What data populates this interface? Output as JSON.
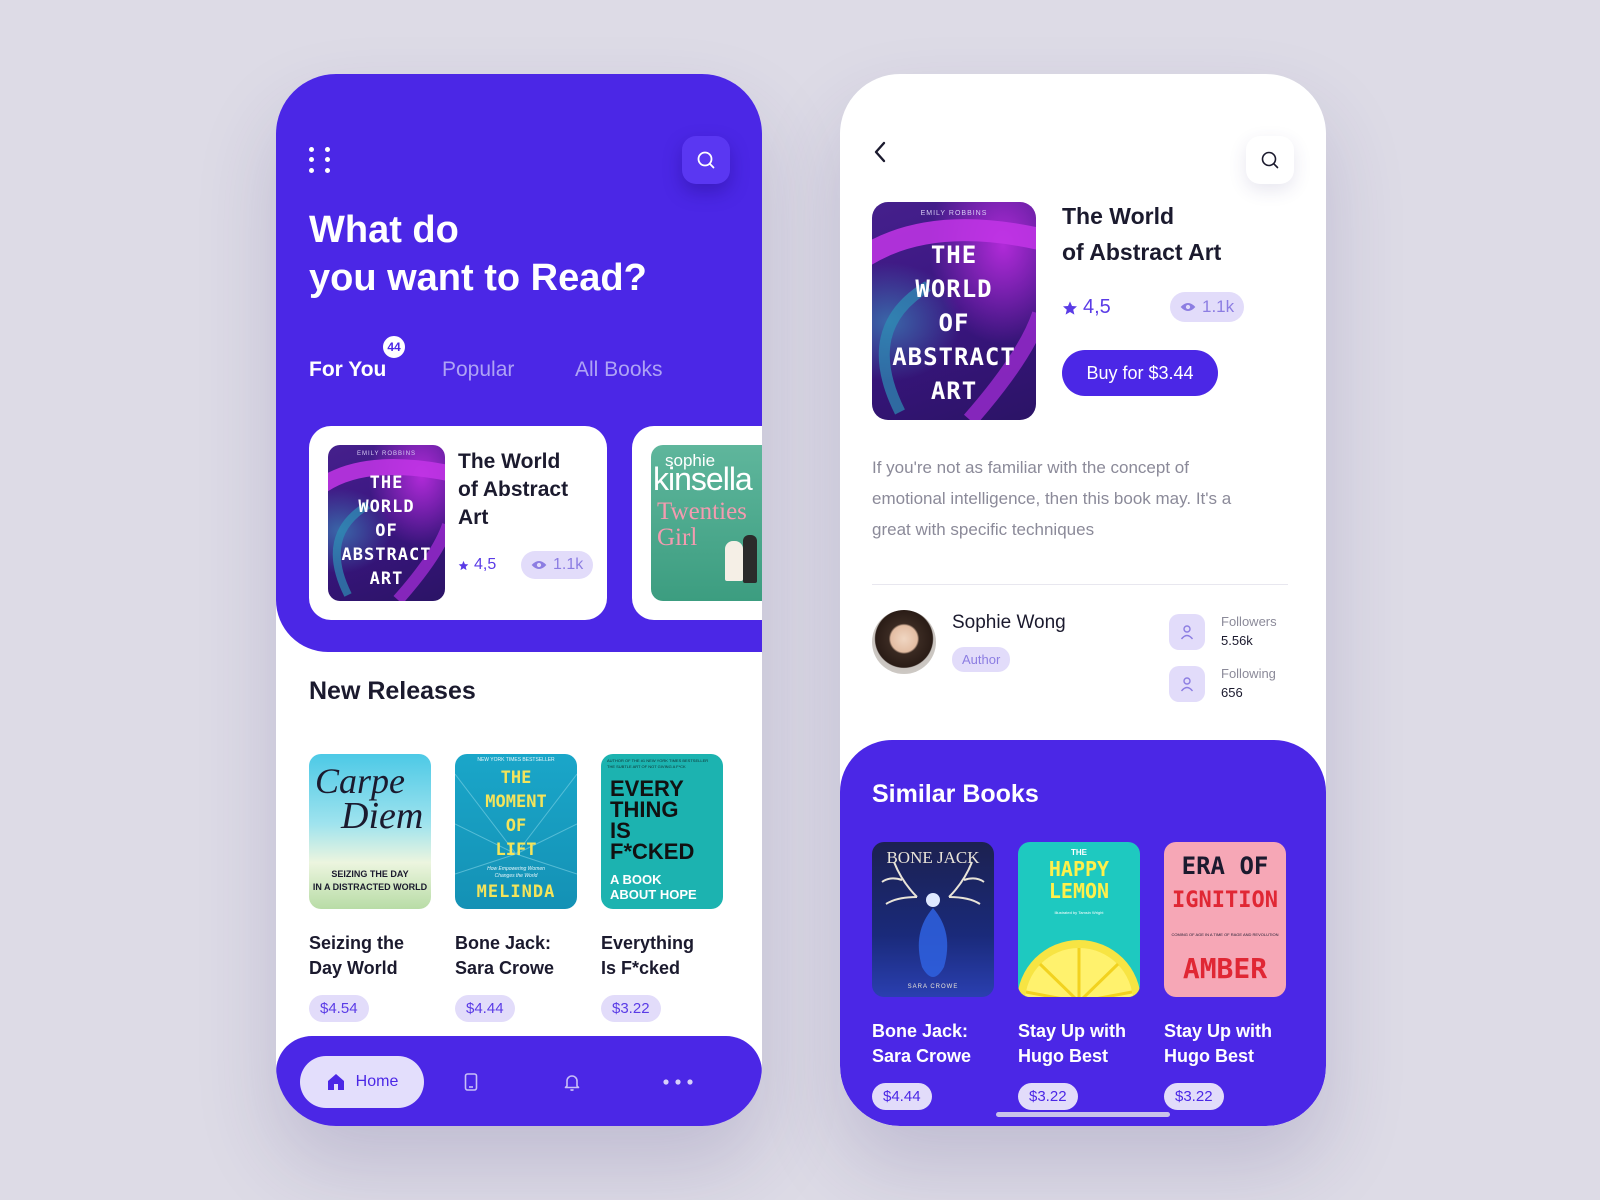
{
  "colors": {
    "background": "#dddbe6",
    "primary": "#4b27e6",
    "pill_bg": "#e2dcfa",
    "text_dark": "#1b1a2e",
    "text_muted": "#8b8a99"
  },
  "home": {
    "title": "What do\nyou want to Read?",
    "menu_icon": "dots-grid-icon",
    "search_icon": "search-icon",
    "tabs": [
      {
        "label": "For You",
        "badge": "44",
        "active": true
      },
      {
        "label": "Popular",
        "active": false
      },
      {
        "label": "All Books",
        "active": false
      }
    ],
    "featured": {
      "title": "The World\nof Abstract\nArt",
      "cover_text": "THE\nWORLD\nOF\nABSTRACT\nART",
      "cover_author": "EMILY ROBBINS",
      "rating": "4,5",
      "views": "1.1k"
    },
    "featured_next": {
      "cover_author": "sophie",
      "cover_brand": "kinsella",
      "cover_title": "Twenties\nGirl"
    },
    "new_releases_title": "New Releases",
    "new_releases": [
      {
        "title": "Seizing the\nDay World",
        "price": "$4.54",
        "cover_line1": "Carpe",
        "cover_line2": "Diem",
        "cover_sub": "SEIZING THE DAY\nIN A DISTRACTED WORLD"
      },
      {
        "title": "Bone Jack:\nSara Crowe",
        "price": "$4.44",
        "cover_top": "NEW YORK TIMES BESTSELLER",
        "cover_main": "THE\nMOMENT\nOF\nLIFT",
        "cover_sub": "How Empowering Women\nChanges the World",
        "cover_author": "MELINDA"
      },
      {
        "title": "Everything\nIs F*cked",
        "price": "$3.22",
        "cover_top": "AUTHOR OF THE #1 NEW YORK TIMES BESTSELLER\nTHE SUBTLE ART OF NOT GIVING A F*CK",
        "cover_main": "EVERY\nTHING\nIS\nF*CKED",
        "cover_sub": "A BOOK\nABOUT HOPE"
      }
    ],
    "nav": {
      "home_label": "Home",
      "home_icon": "home-icon",
      "library_icon": "phone-book-icon",
      "notifications_icon": "bell-icon",
      "more_icon": "more-dots-icon"
    }
  },
  "detail": {
    "back_icon": "chevron-left-icon",
    "search_icon": "search-icon",
    "title": "The World\nof Abstract Art",
    "cover_text": "THE\nWORLD\nOF\nABSTRACT\nART",
    "cover_author": "EMILY ROBBINS",
    "rating": "4,5",
    "views": "1.1k",
    "buy_label": "Buy for $3.44",
    "description": "If you're not as familiar with the concept of emotional intelligence, then this book may. It's a great with specific techniques",
    "author": {
      "name": "Sophie Wong",
      "role": "Author",
      "followers_label": "Followers",
      "followers": "5.56k",
      "following_label": "Following",
      "following": "656"
    },
    "similar_title": "Similar Books",
    "similar": [
      {
        "title": "Bone Jack:\nSara Crowe",
        "price": "$4.44",
        "cover_title": "BONE JACK",
        "cover_author": "SARA CROWE"
      },
      {
        "title": "Stay Up with\nHugo Best",
        "price": "$3.22",
        "cover_small": "THE",
        "cover_title": "HAPPY\nLEMON",
        "cover_author": "Illustrated by Tamsin Wright"
      },
      {
        "title": "Stay Up with\nHugo Best",
        "price": "$3.22",
        "cover_top": "ERA OF",
        "cover_main": "IGNITION",
        "cover_sub": "COMING OF AGE IN A TIME OF RAGE AND REVOLUTION",
        "cover_author": "AMBER"
      }
    ]
  }
}
